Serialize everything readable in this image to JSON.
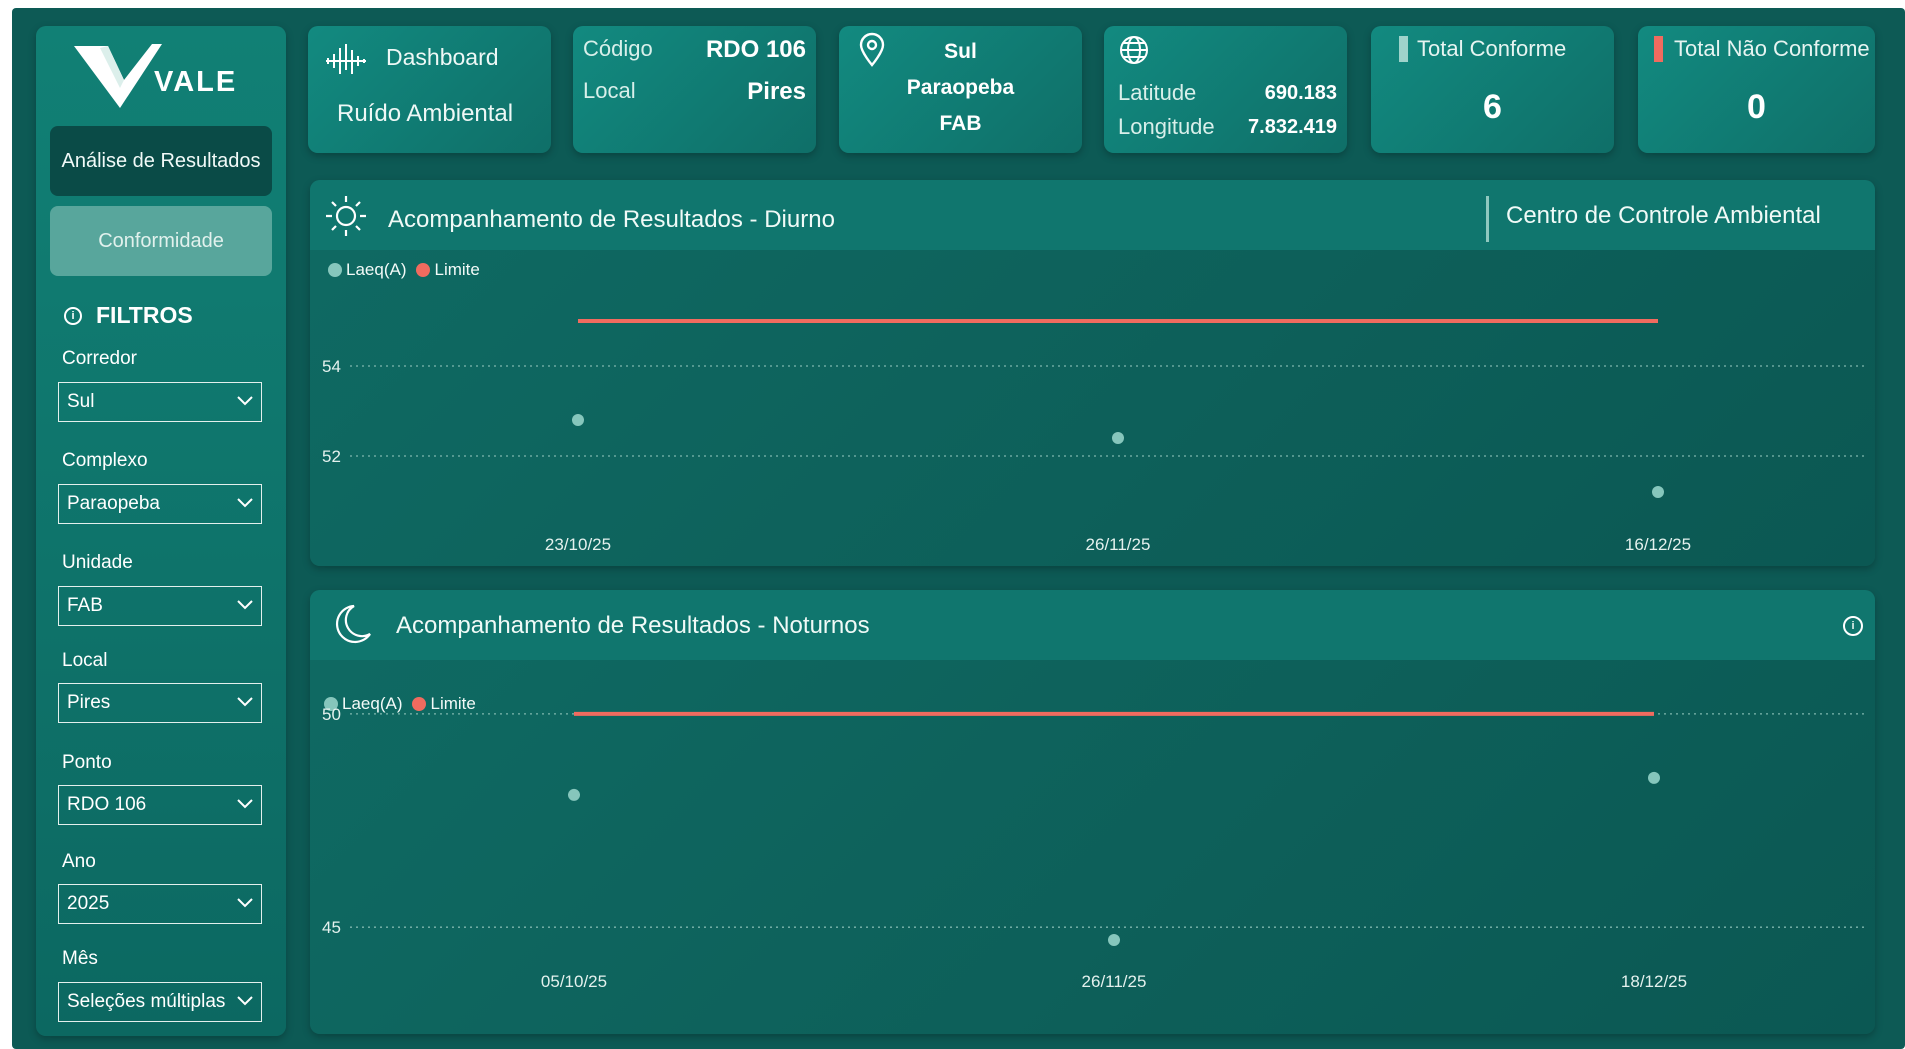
{
  "brand": {
    "name": "VALE"
  },
  "sidebar": {
    "nav": [
      {
        "label": "Análise de Resultados"
      },
      {
        "label": "Conformidade"
      }
    ],
    "filters_title": "FILTROS",
    "filters": [
      {
        "label": "Corredor",
        "value": "Sul"
      },
      {
        "label": "Complexo",
        "value": "Paraopeba"
      },
      {
        "label": "Unidade",
        "value": "FAB"
      },
      {
        "label": "Local",
        "value": "Pires"
      },
      {
        "label": "Ponto",
        "value": "RDO 106"
      },
      {
        "label": "Ano",
        "value": "2025"
      },
      {
        "label": "Mês",
        "value": "Seleções múltiplas"
      }
    ]
  },
  "header": {
    "dashboard": {
      "title": "Dashboard",
      "subtitle": "Ruído Ambiental"
    },
    "codigo": {
      "label": "Código",
      "value": "RDO 106",
      "local_label": "Local",
      "local_value": "Pires"
    },
    "location": {
      "line1": "Sul",
      "line2": "Paraopeba",
      "line3": "FAB"
    },
    "coords": {
      "lat_label": "Latitude",
      "lat_value": "690.183",
      "lon_label": "Longitude",
      "lon_value": "7.832.419"
    },
    "total_conforme": {
      "label": "Total Conforme",
      "value": "6"
    },
    "total_nao_conforme": {
      "label": "Total Não Conforme",
      "value": "0"
    }
  },
  "colors": {
    "conforme_bar": "#9fd3cb",
    "nao_conforme_bar": "#f06b5f",
    "laeq": "#86c6bc",
    "limite": "#f06b5f"
  },
  "panels": {
    "diurno": {
      "title": "Acompanhamento de Resultados - Diurno",
      "right_title": "Centro de Controle Ambiental"
    },
    "noturno": {
      "title": "Acompanhamento de Resultados - Noturnos"
    }
  },
  "chart_data": [
    {
      "type": "scatter",
      "title": "Acompanhamento de Resultados - Diurno",
      "x": [
        "23/10/25",
        "26/11/25",
        "16/12/25"
      ],
      "y_ticks": [
        52,
        54
      ],
      "ylim": [
        50.8,
        56.0
      ],
      "grid": true,
      "legend_position": "top-left",
      "series": [
        {
          "name": "Laeq(A)",
          "values": [
            52.8,
            52.4,
            51.2
          ]
        },
        {
          "name": "Limite",
          "values": [
            55,
            55,
            55
          ]
        }
      ]
    },
    {
      "type": "scatter",
      "title": "Acompanhamento de Resultados - Noturnos",
      "x": [
        "05/10/25",
        "26/11/25",
        "18/12/25"
      ],
      "y_ticks": [
        45,
        50
      ],
      "ylim": [
        44.7,
        50.7
      ],
      "grid": true,
      "legend_position": "top-left",
      "series": [
        {
          "name": "Laeq(A)",
          "values": [
            48.1,
            44.7,
            48.5
          ]
        },
        {
          "name": "Limite",
          "values": [
            50,
            50,
            50
          ]
        }
      ]
    }
  ]
}
